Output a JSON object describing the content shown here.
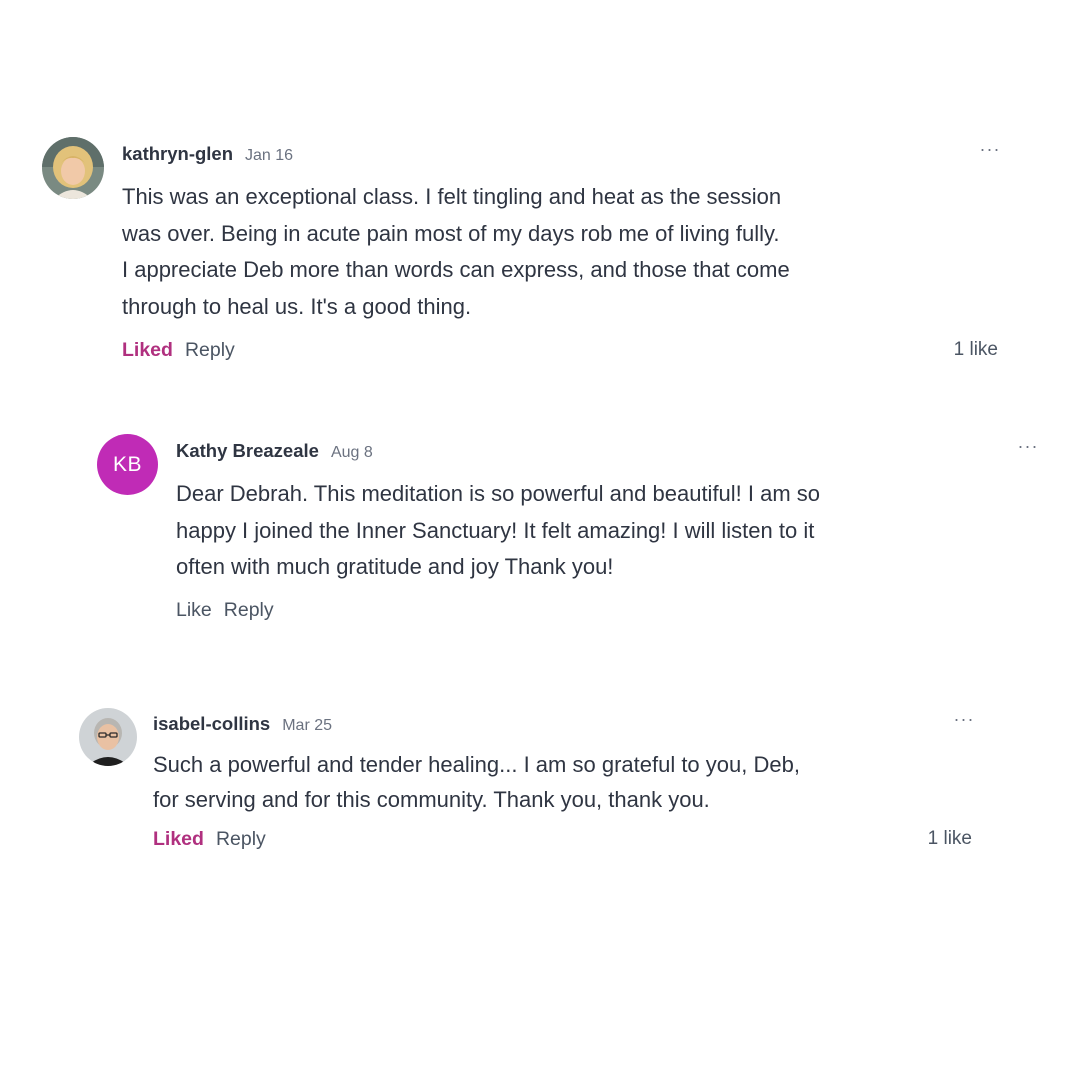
{
  "comments": [
    {
      "author": "kathryn-glen",
      "date": "Jan 16",
      "avatar": "photo-avatar",
      "more_icon": "···",
      "body": [
        "This was an exceptional class. I felt tingling and heat as the session",
        "was over. Being in acute pain most of my days rob me of living fully.",
        "I appreciate Deb more than words can express, and those that come",
        "through to heal us. It's a good thing."
      ],
      "like_label": "Liked",
      "liked": true,
      "reply_label": "Reply",
      "likes_count": "1 like"
    },
    {
      "author": "Kathy Breazeale",
      "date": "Aug 8",
      "avatar_initials": "KB",
      "avatar_color": "#c02bb6",
      "more_icon": "···",
      "body": [
        "Dear Debrah. This meditation is so powerful and beautiful! I am so",
        "happy I joined the Inner Sanctuary! It felt amazing! I will listen to it",
        "often with much gratitude and joy Thank you!"
      ],
      "like_label": "Like",
      "liked": false,
      "reply_label": "Reply"
    },
    {
      "author": "isabel-collins",
      "date": "Mar 25",
      "avatar": "photo-avatar",
      "more_icon": "···",
      "body": [
        "Such a powerful and tender healing... I am so grateful to you, Deb,",
        "for serving and for this community. Thank you, thank you."
      ],
      "like_label": "Liked",
      "liked": true,
      "reply_label": "Reply",
      "likes_count": "1 like"
    }
  ],
  "colors": {
    "liked": "#b0307f",
    "text": "#2f3542",
    "muted": "#6b7280"
  }
}
